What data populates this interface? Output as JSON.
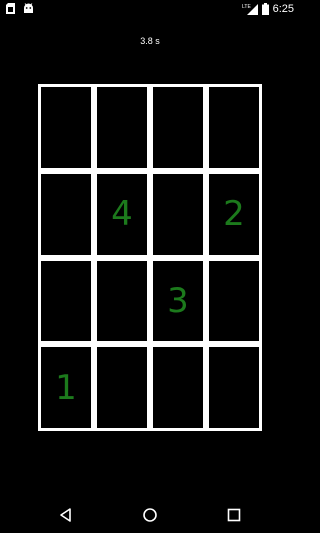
{
  "status_bar": {
    "lte_label": "LTE",
    "time": "6:25",
    "icons": [
      "sim-card-icon",
      "android-debug-icon",
      "lte-signal-icon",
      "battery-icon"
    ]
  },
  "game": {
    "timer": "3.8 s",
    "grid_rows": 4,
    "grid_cols": 4,
    "cells": [
      [
        "",
        "",
        "",
        ""
      ],
      [
        "",
        "4",
        "",
        "2"
      ],
      [
        "",
        "",
        "3",
        ""
      ],
      [
        "1",
        "",
        "",
        ""
      ]
    ],
    "number_color": "#1c7a1c",
    "cell_border_color": "#ffffff"
  },
  "nav_bar": {
    "icons": [
      "back-icon",
      "home-icon",
      "recents-icon"
    ]
  }
}
